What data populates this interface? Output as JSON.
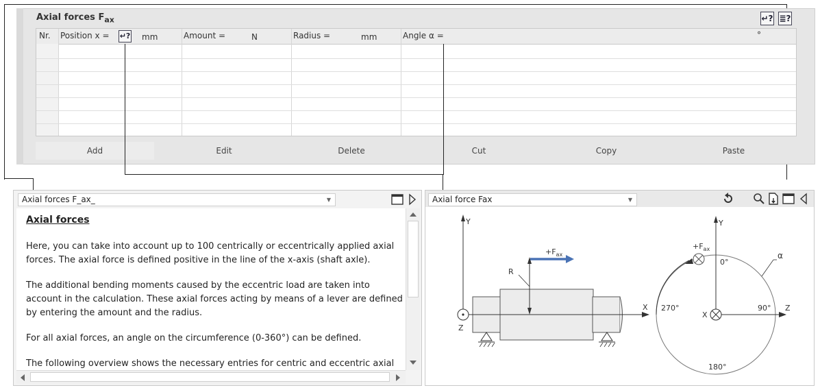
{
  "top_panel": {
    "title": "Axial forces F",
    "title_sub": "ax",
    "columns": {
      "nr": "Nr.",
      "position": "Position x =",
      "position_unit": "mm",
      "amount": "Amount =",
      "amount_unit": "N",
      "radius": "Radius =",
      "radius_unit": "mm",
      "angle": "Angle α =",
      "angle_unit": "°"
    },
    "buttons": {
      "add": "Add",
      "edit": "Edit",
      "delete": "Delete",
      "cut": "Cut",
      "copy": "Copy",
      "paste": "Paste"
    },
    "help_icon_glyph": "↵?",
    "doc_icon_glyph": "≣?"
  },
  "help_panel": {
    "selector_value": "Axial forces F_ax_",
    "heading": "Axial forces",
    "paragraphs": [
      "Here, you can take into account up to 100 centrically or eccentrically applied axial forces. The axial force is defined positive in the line of the x-axis (shaft axle).",
      "The additional bending moments caused by the eccentric load are taken into account in the calculation. These axial forces acting by means of a lever are defined by entering the amount and the radius.",
      "For all axial forces, an angle on the circumference (0-360°) can be defined.",
      "The following overview shows the necessary entries for centric and eccentric axial loads:"
    ]
  },
  "graphic_panel": {
    "selector_value": "Axial force Fax",
    "labels": {
      "y_left": "Y",
      "z_left": "Z",
      "x_left": "X",
      "r": "R",
      "fax_left": "+F",
      "fax_left_sub": "ax",
      "y_right": "Y",
      "z_right": "Z",
      "x_right": "X",
      "fax_right": "+F",
      "fax_right_sub": "ax",
      "alpha": "α",
      "deg0": "0°",
      "deg90": "90°",
      "deg180": "180°",
      "deg270": "270°"
    }
  },
  "colors": {
    "arrow_blue": "#4a73b5",
    "panel_gray": "#e6e6e6"
  }
}
